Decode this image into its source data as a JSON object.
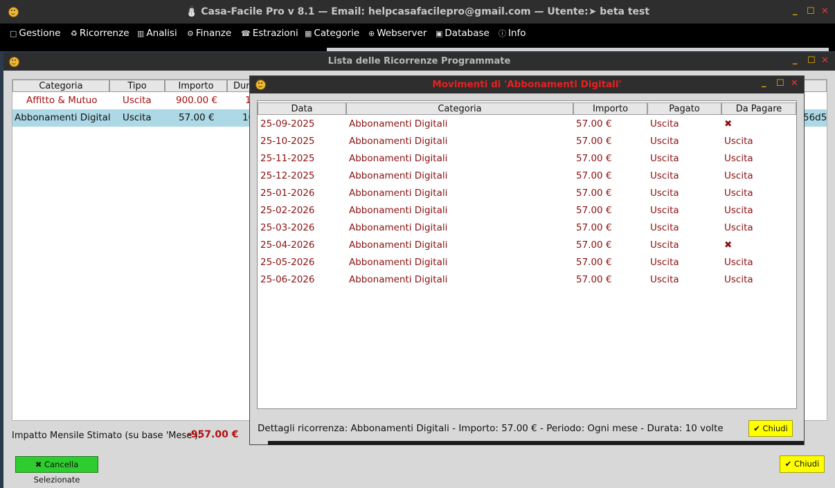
{
  "main_window": {
    "title": "⛄ Casa-Facile Pro v 8.1  — Email: helpcasafacilepro@gmail.com —  Utente:➤ beta test",
    "controls": {
      "minimize": "_",
      "maximize": "☐",
      "close": "✕"
    }
  },
  "menu": [
    {
      "icon": "□",
      "icon_name": "folder-icon",
      "label": "Gestione"
    },
    {
      "icon": "♻",
      "icon_name": "recycle-icon",
      "label": "Ricorrenze"
    },
    {
      "icon": "📊",
      "icon_name": "chart-icon",
      "label": "Analisi"
    },
    {
      "icon": "⚙",
      "icon_name": "finance-icon",
      "label": "Finanze"
    },
    {
      "icon": "☎",
      "icon_name": "extract-icon",
      "label": "Estrazioni"
    },
    {
      "icon": "▦",
      "icon_name": "categories-icon",
      "label": "Categorie"
    },
    {
      "icon": "⊕",
      "icon_name": "globe-icon",
      "label": "Webserver"
    },
    {
      "icon": "▣",
      "icon_name": "save-icon",
      "label": "Database"
    },
    {
      "icon": "ⓘ",
      "icon_name": "info-icon",
      "label": "Info"
    }
  ],
  "list_window": {
    "title": "Lista delle Ricorrenze Programmate",
    "columns": [
      "Categoria",
      "Tipo",
      "Importo",
      "Dura"
    ],
    "rows": [
      {
        "categoria": "Affitto & Mutuo",
        "tipo": "Uscita",
        "importo": "900.00 €",
        "durata": "1",
        "extra": ""
      },
      {
        "categoria": "Abbonamenti Digital",
        "tipo": "Uscita",
        "importo": "57.00 €",
        "durata": "10",
        "extra": "56d5"
      }
    ],
    "impact_label": "Impatto Mensile Stimato (su base 'Mese'):",
    "impact_value": "-957.00 €",
    "delete_button": "✖ Cancella Selezionate",
    "close_button": "✔ Chiudi"
  },
  "dialog": {
    "title": "Movimenti di 'Abbonamenti Digitali'",
    "columns": [
      "Data",
      "Categoria",
      "Importo",
      "Pagato",
      "Da Pagare"
    ],
    "rows": [
      {
        "data": "25-09-2025",
        "categoria": "Abbonamenti Digitali",
        "importo": "57.00 €",
        "pagato": "Uscita",
        "da_pagare": "✖"
      },
      {
        "data": "25-10-2025",
        "categoria": "Abbonamenti Digitali",
        "importo": "57.00 €",
        "pagato": "Uscita",
        "da_pagare": "Uscita"
      },
      {
        "data": "25-11-2025",
        "categoria": "Abbonamenti Digitali",
        "importo": "57.00 €",
        "pagato": "Uscita",
        "da_pagare": "Uscita"
      },
      {
        "data": "25-12-2025",
        "categoria": "Abbonamenti Digitali",
        "importo": "57.00 €",
        "pagato": "Uscita",
        "da_pagare": "Uscita"
      },
      {
        "data": "25-01-2026",
        "categoria": "Abbonamenti Digitali",
        "importo": "57.00 €",
        "pagato": "Uscita",
        "da_pagare": "Uscita"
      },
      {
        "data": "25-02-2026",
        "categoria": "Abbonamenti Digitali",
        "importo": "57.00 €",
        "pagato": "Uscita",
        "da_pagare": "Uscita"
      },
      {
        "data": "25-03-2026",
        "categoria": "Abbonamenti Digitali",
        "importo": "57.00 €",
        "pagato": "Uscita",
        "da_pagare": "Uscita"
      },
      {
        "data": "25-04-2026",
        "categoria": "Abbonamenti Digitali",
        "importo": "57.00 €",
        "pagato": "Uscita",
        "da_pagare": "✖"
      },
      {
        "data": "25-05-2026",
        "categoria": "Abbonamenti Digitali",
        "importo": "57.00 €",
        "pagato": "Uscita",
        "da_pagare": "Uscita"
      },
      {
        "data": "25-06-2026",
        "categoria": "Abbonamenti Digitali",
        "importo": "57.00 €",
        "pagato": "Uscita",
        "da_pagare": "Uscita"
      }
    ],
    "details": "Dettagli ricorrenza: Abbonamenti Digitali - Importo: 57.00 € - Periodo: Ogni mese - Durata: 10 volte",
    "close_button": "✔ Chiudi"
  },
  "colors": {
    "accent_red": "#8b1010",
    "title_red": "#e82020",
    "selection": "#add8e6",
    "green_button": "#2ecc2e",
    "yellow_button": "#ffff00"
  }
}
